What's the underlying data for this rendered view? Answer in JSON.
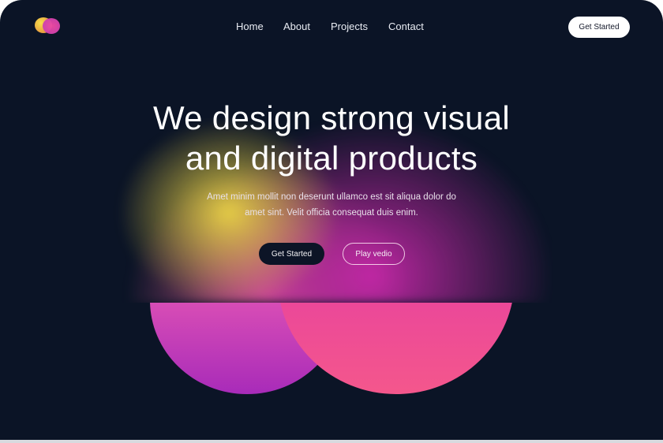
{
  "nav": {
    "logo_icon": "overlapping-circles-logo",
    "links": [
      "Home",
      "About",
      "Projects",
      "Contact"
    ],
    "cta_label": "Get Started"
  },
  "hero": {
    "headline_line1": "We design strong visual",
    "headline_line2": "and digital products",
    "subtext_line1": "Amet minim mollit non deserunt ullamco est sit aliqua dolor do",
    "subtext_line2": "amet sint. Velit officia consequat duis enim.",
    "primary_button": "Get Started",
    "secondary_button": "Play vedio"
  },
  "colors": {
    "background": "#0b1426",
    "accent_pink": "#f4578c",
    "accent_magenta": "#c23bb4",
    "accent_yellow": "#eed646",
    "button_light": "#ffffff"
  }
}
